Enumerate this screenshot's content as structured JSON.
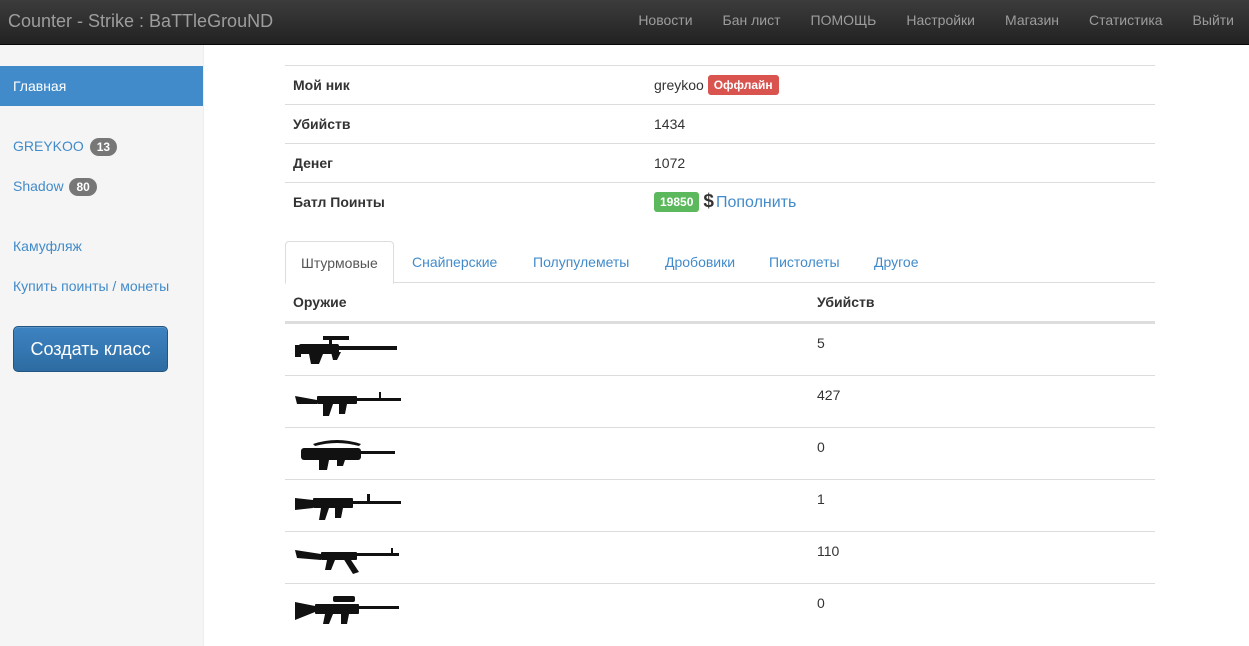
{
  "navbar": {
    "brand": "Counter - Strike : BaTTleGrouND",
    "links": [
      "Новости",
      "Бан лист",
      "ПОМОЩЬ",
      "Настройки",
      "Магазин",
      "Статистика",
      "Выйти"
    ]
  },
  "sidebar": {
    "home": "Главная",
    "players": [
      {
        "name": "GREYKOO",
        "count": "13"
      },
      {
        "name": "Shadow",
        "count": "80"
      }
    ],
    "camo": "Камуфляж",
    "buy": "Купить поинты / монеты",
    "create_class": "Создать класс"
  },
  "profile": {
    "nick_label": "Мой ник",
    "nick": "greykoo",
    "status": "Оффлайн",
    "kills_label": "Убийств",
    "kills": "1434",
    "money_label": "Денег",
    "money": "1072",
    "bp_label": "Батл Поинты",
    "bp": "19850",
    "currency": "$",
    "topup": "Пополнить"
  },
  "colors": {
    "accent": "#428bca",
    "danger": "#d9534f",
    "success": "#5cb85c"
  },
  "tabs": [
    "Штурмовые",
    "Снайперские",
    "Полупулеметы",
    "Дробовики",
    "Пистолеты",
    "Другое"
  ],
  "weapons": {
    "headers": {
      "weapon": "Оружие",
      "kills": "Убийств"
    },
    "rows": [
      {
        "icon": "aug-rifle-icon",
        "kills": "5"
      },
      {
        "icon": "galil-rifle-icon",
        "kills": "427"
      },
      {
        "icon": "famas-rifle-icon",
        "kills": "0"
      },
      {
        "icon": "m4a1-rifle-icon",
        "kills": "1"
      },
      {
        "icon": "ak47-rifle-icon",
        "kills": "110"
      },
      {
        "icon": "sg552-rifle-icon",
        "kills": "0"
      }
    ]
  }
}
